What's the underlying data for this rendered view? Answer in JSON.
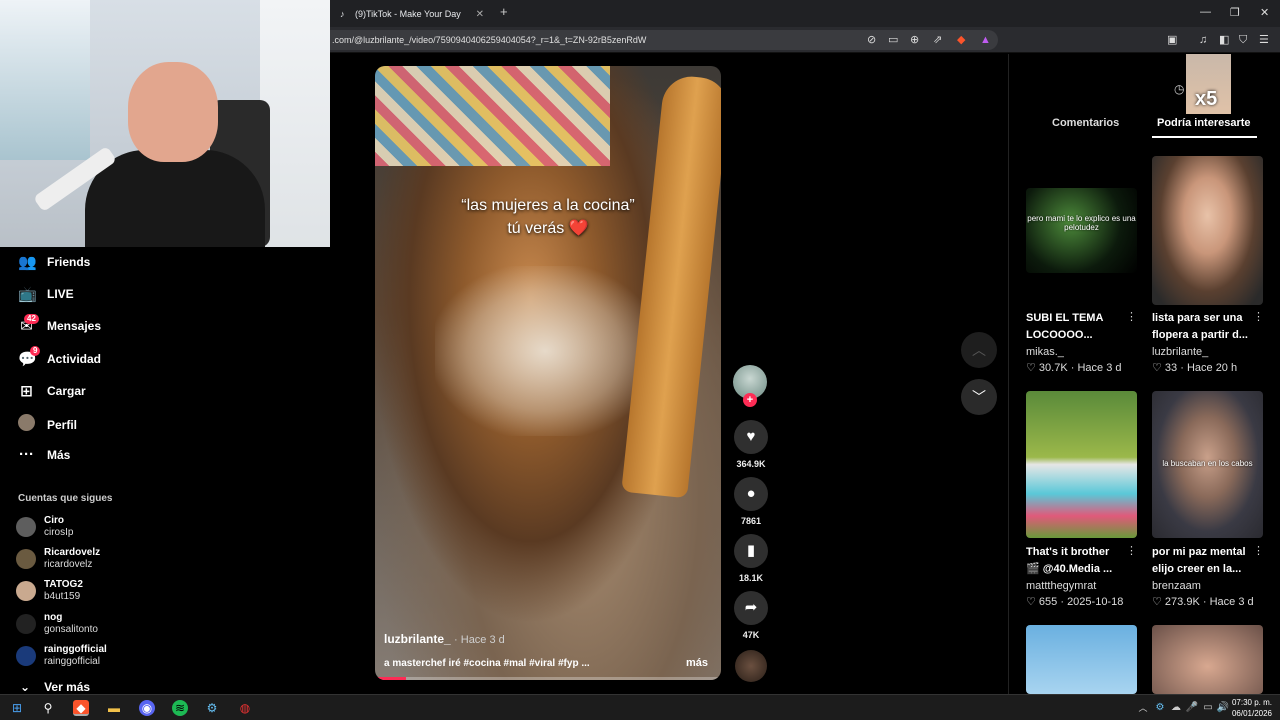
{
  "browser": {
    "tab_title": "(9)TikTok - Make Your Day",
    "new_tab": "+",
    "url": ".com/@luzbrilante_/video/7590940406259404054?_r=1&_t=ZN-92rB5zenRdW"
  },
  "nav": {
    "items": [
      {
        "label": "Friends",
        "icon": "friends-icon"
      },
      {
        "label": "LIVE",
        "icon": "live-icon"
      },
      {
        "label": "Mensajes",
        "icon": "messages-icon",
        "badge": "42"
      },
      {
        "label": "Actividad",
        "icon": "activity-icon",
        "badge": "9"
      },
      {
        "label": "Cargar",
        "icon": "upload-icon"
      },
      {
        "label": "Perfil",
        "icon": "profile-icon"
      },
      {
        "label": "Más",
        "icon": "more-icon"
      }
    ],
    "following_title": "Cuentas que sigues",
    "following": [
      {
        "name": "Ciro",
        "handle": "cirosIp"
      },
      {
        "name": "Ricardovelz",
        "handle": "ricardovelz"
      },
      {
        "name": "TATOG2",
        "handle": "b4ut159"
      },
      {
        "name": "nog",
        "handle": "gonsalitonto"
      },
      {
        "name": "rainggofficial",
        "handle": "rainggofficial"
      }
    ],
    "see_more": "Ver más"
  },
  "video": {
    "caption_line1": "“las mujeres a la cocina”",
    "caption_line2": "tú verás ❤️",
    "author": "luzbrilante_",
    "ago": "· Hace 3 d",
    "description": "a masterchef iré #cocina #mal #viral #fyp ...",
    "more": "más",
    "progress_percent": 9
  },
  "actions": {
    "likes": "364.9K",
    "comments": "7861",
    "saves": "18.1K",
    "shares": "47K"
  },
  "right_panel": {
    "tabs": [
      "Comentarios",
      "Podría interesarte"
    ],
    "overlay_count": "x5",
    "cards": [
      {
        "title": "SUBI EL TEMA LOCOOOO...",
        "author": "mikas._",
        "likes": "30.7K",
        "date": "Hace 3 d",
        "overlay": "pero mami te lo explico es una pelotudez"
      },
      {
        "title": "lista para ser una flopera a partir d...",
        "author": "luzbrilante_",
        "likes": "33",
        "date": "Hace 20 h",
        "overlay": ""
      },
      {
        "title": "That's it brother 🎬 @40.Media ...",
        "author": "mattthegymrat",
        "likes": "655",
        "date": "2025-10-18",
        "overlay": ""
      },
      {
        "title": "por mi paz mental elijo creer en la...",
        "author": "brenzaam",
        "likes": "273.9K",
        "date": "Hace 3 d",
        "overlay": "la buscaban en los cabos"
      }
    ]
  },
  "taskbar": {
    "time": "07:30 p. m.",
    "date": "06/01/2026"
  },
  "colors": {
    "accent": "#fe2c55",
    "background": "#000000"
  }
}
